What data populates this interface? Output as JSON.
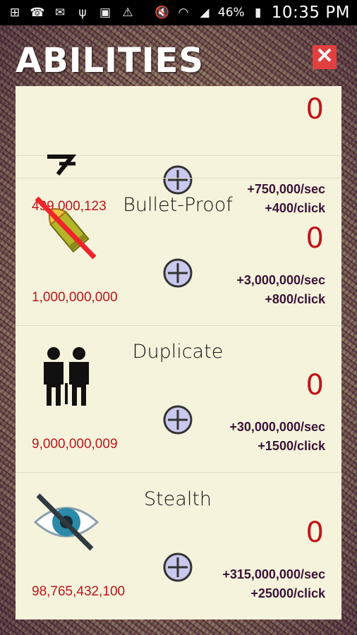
{
  "status_bar": {
    "battery": "46%",
    "time": "10:35 PM",
    "icons": [
      "plus-box-icon",
      "wifi-call-icon",
      "mail-icon",
      "usb-icon",
      "image-icon",
      "warning-icon",
      "mute-icon",
      "wifi-icon",
      "signal-icon",
      "battery-charging-icon"
    ]
  },
  "header": {
    "title": "ABILITIES",
    "close_label": "✕"
  },
  "abilities": [
    {
      "name": "",
      "level": "0",
      "cost": "499,000,123",
      "per_sec": "+750,000/sec",
      "per_click": "+400/click",
      "icon": "dash-arrow-icon"
    },
    {
      "name": "Bullet-Proof",
      "level": "0",
      "cost": "1,000,000,000",
      "per_sec": "+3,000,000/sec",
      "per_click": "+800/click",
      "icon": "bullet-crossed-icon"
    },
    {
      "name": "Duplicate",
      "level": "0",
      "cost": "9,000,000,009",
      "per_sec": "+30,000,000/sec",
      "per_click": "+1500/click",
      "icon": "clones-icon"
    },
    {
      "name": "Stealth",
      "level": "0",
      "cost": "98,765,432,100",
      "per_sec": "+315,000,000/sec",
      "per_click": "+25000/click",
      "icon": "eye-crossed-icon"
    }
  ],
  "colors": {
    "panel": "#f5f3dc",
    "level": "#c0141a",
    "cost": "#c0141a",
    "bonus": "#3a1238",
    "close": "#e24040"
  }
}
